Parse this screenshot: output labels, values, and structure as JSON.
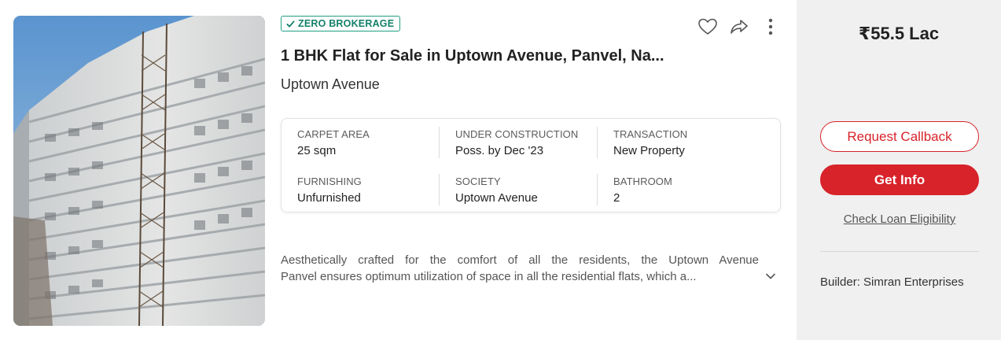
{
  "listing": {
    "badge": "ZERO BROKERAGE",
    "title": "1 BHK Flat for Sale in Uptown Avenue, Panvel, Na...",
    "project": "Uptown Avenue",
    "summary": {
      "carpet_area": {
        "label": "CARPET AREA",
        "value": "25 sqm"
      },
      "status": {
        "label": "UNDER CONSTRUCTION",
        "value": "Poss. by Dec '23"
      },
      "transaction": {
        "label": "TRANSACTION",
        "value": "New Property"
      },
      "furnishing": {
        "label": "FURNISHING",
        "value": "Unfurnished"
      },
      "society": {
        "label": "SOCIETY",
        "value": "Uptown Avenue"
      },
      "bathroom": {
        "label": "BATHROOM",
        "value": "2"
      }
    },
    "description_line1": "Aesthetically crafted for the comfort of all the residents, the Uptown Avenue",
    "description_line2": "Panvel ensures optimum utilization of space in all the residential flats, which a..."
  },
  "icons": {
    "badge": "check-icon",
    "favourite": "heart-icon",
    "share": "share-icon",
    "more": "more-vertical-icon",
    "expand": "chevron-down-icon"
  },
  "side": {
    "price": "₹55.5 Lac",
    "request_callback": "Request Callback",
    "get_info": "Get Info",
    "loan_link": "Check Loan Eligibility",
    "builder": "Builder: Simran Enterprises"
  },
  "colors": {
    "accent": "#d8232a",
    "badge": "#1f9e83",
    "panel": "#f0f0f0"
  }
}
